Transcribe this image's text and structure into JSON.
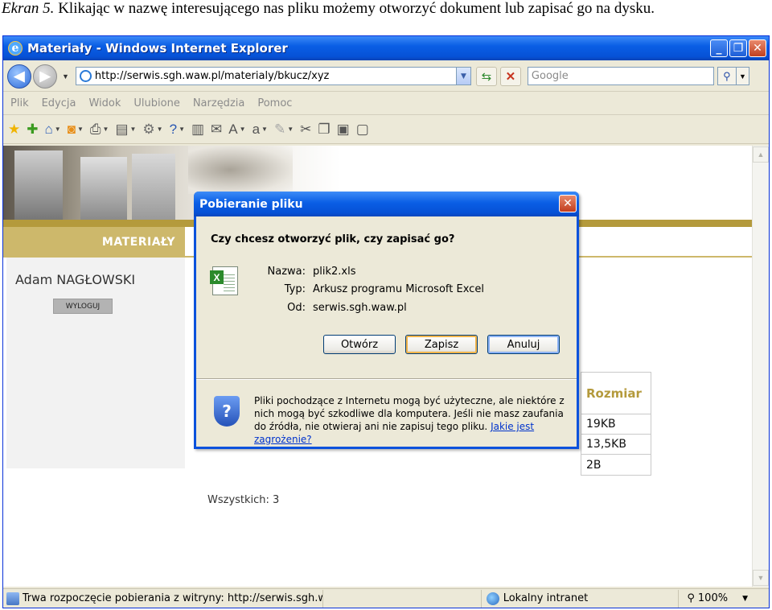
{
  "caption": {
    "prefix": "Ekran 5.",
    "text": " Klikając w nazwę interesującego nas pliku możemy otworzyć dokument lub zapisać go na dysku."
  },
  "window": {
    "title": "Materiały - Windows Internet Explorer",
    "min": "_",
    "max": "❐",
    "close": "✕"
  },
  "address": {
    "url": "http://serwis.sgh.waw.pl/materialy/bkucz/xyz",
    "search_placeholder": "Google"
  },
  "menu": [
    "Plik",
    "Edycja",
    "Widok",
    "Ulubione",
    "Narzędzia",
    "Pomoc"
  ],
  "page": {
    "section": "MATERIAŁY",
    "user": "Adam NAGŁOWSKI",
    "logout": "WYLOGUJ",
    "size_header": "Rozmiar",
    "sizes": [
      "19KB",
      "13,5KB",
      "2B"
    ],
    "total": "Wszystkich: 3"
  },
  "dialog": {
    "title": "Pobieranie pliku",
    "question": "Czy chcesz otworzyć plik, czy zapisać go?",
    "name_label": "Nazwa:",
    "name_value": "plik2.xls",
    "type_label": "Typ:",
    "type_value": "Arkusz programu Microsoft Excel",
    "from_label": "Od:",
    "from_value": "serwis.sgh.waw.pl",
    "open_btn": "Otwórz",
    "save_btn": "Zapisz",
    "cancel_btn": "Anuluj",
    "warning": "Pliki pochodzące z Internetu mogą być użyteczne, ale niektóre z nich mogą być szkodliwe dla komputera. Jeśli nie masz zaufania do źródła, nie otwieraj ani nie zapisuj tego pliku. ",
    "warning_link": "Jakie jest zagrożenie?"
  },
  "status": {
    "text": "Trwa rozpoczęcie pobierania z witryny: http://serwis.sgh.waw.pl/n",
    "zone": "Lokalny intranet",
    "zoom": "100%"
  },
  "colors": {
    "accent": "#b49a3c",
    "xp_blue": "#0a5ee5"
  }
}
